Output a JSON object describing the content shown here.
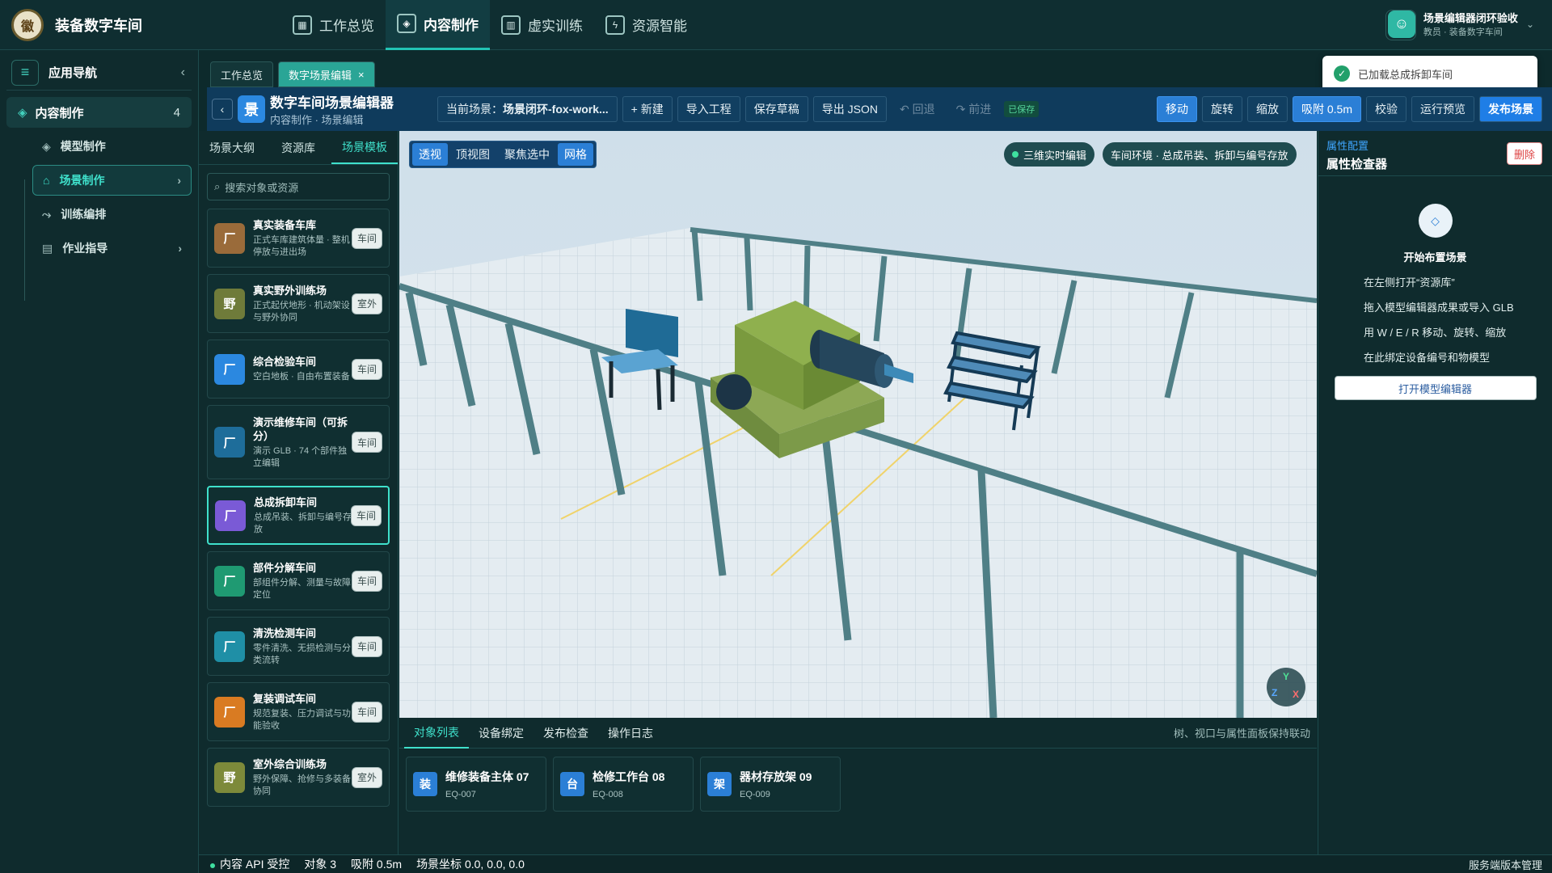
{
  "app": {
    "title": "装备数字车间",
    "logo_text": "徽"
  },
  "nav": {
    "tabs": [
      {
        "label": "工作总览",
        "icon": "grid-icon"
      },
      {
        "label": "内容制作",
        "icon": "cube-icon"
      },
      {
        "label": "虚实训练",
        "icon": "book-icon"
      },
      {
        "label": "资源智能",
        "icon": "bolt-icon"
      }
    ]
  },
  "user": {
    "name": "场景编辑器闭环验收",
    "role": "教员 · 装备数字车间"
  },
  "sidebar": {
    "title": "应用导航",
    "group": {
      "label": "内容制作",
      "count": "4"
    },
    "items": [
      {
        "label": "模型制作"
      },
      {
        "label": "场景制作"
      },
      {
        "label": "训练编排"
      },
      {
        "label": "作业指导"
      }
    ]
  },
  "workspace_tabs": [
    {
      "label": "工作总览"
    },
    {
      "label": "数字场景编辑",
      "close": "×"
    }
  ],
  "toast": {
    "text": "已加载总成拆卸车间"
  },
  "editor": {
    "icon_text": "景",
    "title": "数字车间场景编辑器",
    "breadcrumb": "内容制作 · 场景编辑",
    "scene_label": "当前场景：",
    "scene_value": "场景闭环-fox-work...",
    "new": "+ 新建",
    "import": "导入工程",
    "save": "保存草稿",
    "export": "导出 JSON",
    "undo": "↶ 回退",
    "redo": "↷ 前进",
    "saved": "已保存",
    "move": "移动",
    "rotate": "旋转",
    "scale": "缩放",
    "snap": "吸附 0.5m",
    "validate": "校验",
    "preview": "运行预览",
    "publish": "发布场景"
  },
  "left_panel": {
    "tabs": [
      "场景大纲",
      "资源库",
      "场景模板"
    ],
    "search_placeholder": "搜索对象或资源",
    "templates": [
      {
        "icon": "厂",
        "color": "#9a6b3a",
        "name": "真实装备车库",
        "desc": "正式车库建筑体量 · 整机停放与进出场",
        "tag": "车间"
      },
      {
        "icon": "野",
        "color": "#6f7b3a",
        "name": "真实野外训练场",
        "desc": "正式起伏地形 · 机动架设与野外协同",
        "tag": "室外"
      },
      {
        "icon": "厂",
        "color": "#2b88e0",
        "name": "综合检验车间",
        "desc": "空白地板 · 自由布置装备",
        "tag": "车间"
      },
      {
        "icon": "厂",
        "color": "#1e6d9a",
        "name": "演示维修车间（可拆分）",
        "desc": "演示 GLB · 74 个部件独立编辑",
        "tag": "车间"
      },
      {
        "icon": "厂",
        "color": "#7a5ad6",
        "name": "总成拆卸车间",
        "desc": "总成吊装、拆卸与编号存放",
        "tag": "车间"
      },
      {
        "icon": "厂",
        "color": "#1f9a72",
        "name": "部件分解车间",
        "desc": "部组件分解、测量与故障定位",
        "tag": "车间"
      },
      {
        "icon": "厂",
        "color": "#1f8fa6",
        "name": "清洗检测车间",
        "desc": "零件清洗、无损检测与分类流转",
        "tag": "车间"
      },
      {
        "icon": "厂",
        "color": "#d97b22",
        "name": "复装调试车间",
        "desc": "规范复装、压力调试与功能验收",
        "tag": "车间"
      },
      {
        "icon": "野",
        "color": "#7d8a3a",
        "name": "室外综合训练场",
        "desc": "野外保障、抢修与多装备协同",
        "tag": "室外"
      }
    ]
  },
  "viewport": {
    "modes": [
      "透视",
      "顶视图",
      "聚焦选中",
      "网格"
    ],
    "live": "三维实时编辑",
    "env": "车间环境 · 总成吊装、拆卸与编号存放",
    "gizmo": {
      "y": "Y",
      "z": "Z",
      "x": "X"
    }
  },
  "bottom_panel": {
    "tabs": [
      "对象列表",
      "设备绑定",
      "发布检查",
      "操作日志"
    ],
    "hint": "树、视口与属性面板保持联动",
    "objects": [
      {
        "icon": "装",
        "name": "维修装备主体 07",
        "code": "EQ-007"
      },
      {
        "icon": "台",
        "name": "检修工作台 08",
        "code": "EQ-008"
      },
      {
        "icon": "架",
        "name": "器材存放架 09",
        "code": "EQ-009"
      }
    ]
  },
  "right_panel": {
    "subtitle": "属性配置",
    "title": "属性检查器",
    "delete": "删除",
    "empty_icon": "◇",
    "empty_title": "开始布置场景",
    "lines": [
      "在左侧打开“资源库”",
      "拖入模型编辑器成果或导入 GLB",
      "用 W / E / R 移动、旋转、缩放",
      "在此绑定设备编号和物模型"
    ],
    "open_button": "打开模型编辑器"
  },
  "status": {
    "api": "内容 API 受控",
    "objects": "对象 3",
    "snap": "吸附 0.5m",
    "coords": "场景坐标 0.0, 0.0, 0.0",
    "right": "服务端版本管理"
  }
}
